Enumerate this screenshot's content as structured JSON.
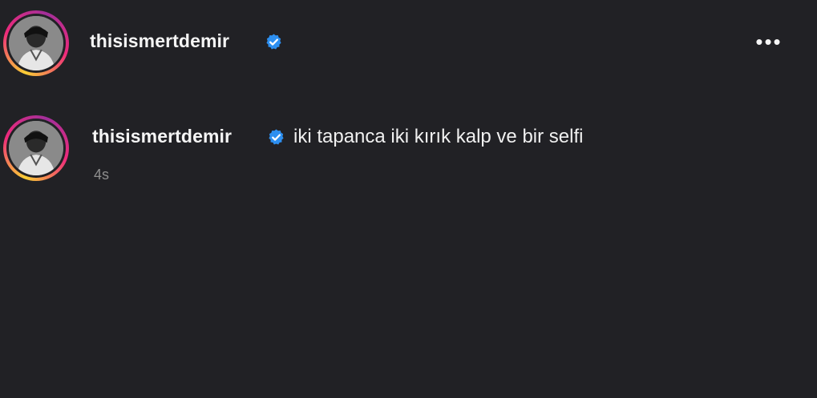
{
  "post": {
    "username": "thisismertdemir",
    "verified_icon": "verified-badge-icon",
    "more_icon": "more-options-icon",
    "more_label": "•••"
  },
  "comment": {
    "username": "thisismertdemir",
    "verified_icon": "verified-badge-icon",
    "text": "iki tapanca iki kırık kalp ve bir selfi",
    "timestamp": "4s"
  },
  "colors": {
    "background": "#212125",
    "verified": "#2d8ff0",
    "muted_text": "#8e8e8e"
  }
}
